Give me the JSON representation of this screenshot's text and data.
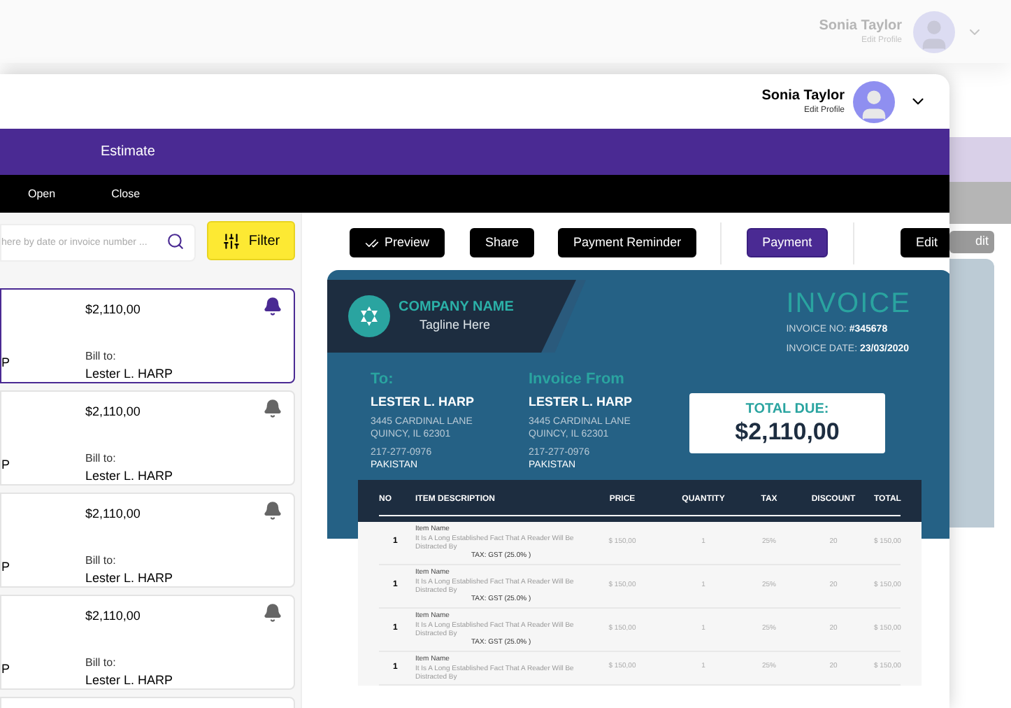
{
  "background": {
    "profile": {
      "name": "Sonia Taylor",
      "subtitle": "Edit Profile"
    },
    "edit_button": "dit"
  },
  "window": {
    "profile": {
      "name": "Sonia Taylor",
      "subtitle": "Edit Profile"
    },
    "nav_tabs": [
      {
        "label": "Estimate"
      }
    ],
    "sub_tabs": [
      {
        "label": "Open"
      },
      {
        "label": "Close"
      }
    ],
    "search": {
      "placeholder": "here by date or invoice number ..."
    },
    "filter_button": "Filter",
    "invoice_cards": [
      {
        "column_1": "P",
        "amount": "$2,110,00",
        "bill_to_label": "Bill to:",
        "bill_to": "Lester L. HARP",
        "selected": true
      },
      {
        "column_1": "P",
        "amount": "$2,110,00",
        "bill_to_label": "Bill to:",
        "bill_to": "Lester L. HARP",
        "selected": false
      },
      {
        "column_1": "P",
        "amount": "$2,110,00",
        "bill_to_label": "Bill to:",
        "bill_to": "Lester L. HARP",
        "selected": false
      },
      {
        "column_1": "P",
        "amount": "$2,110,00",
        "bill_to_label": "Bill to:",
        "bill_to": "Lester L. HARP",
        "selected": false
      }
    ],
    "actions": [
      {
        "label": "Preview",
        "kind": "check"
      },
      {
        "label": "Share",
        "kind": "plain"
      },
      {
        "label": "Payment Reminder",
        "kind": "plain"
      },
      {
        "label": "Payment",
        "kind": "primary"
      },
      {
        "label": "Edit",
        "kind": "plain"
      }
    ],
    "invoice": {
      "company_name": "COMPANY NAME",
      "tagline": "Tagline Here",
      "title": "INVOICE",
      "invoice_no_label": "INVOICE NO:",
      "invoice_no": "#345678",
      "invoice_date_label": "INVOICE DATE:",
      "invoice_date": "23/03/2020",
      "parties": [
        {
          "heading": "To:",
          "name": "LESTER L. HARP",
          "address_1": "3445 CARDINAL LANE",
          "address_2": "QUINCY, IL 62301",
          "phone": "217-277-0976",
          "country": "PAKISTAN"
        },
        {
          "heading": "Invoice From",
          "name": "LESTER L. HARP",
          "address_1": "3445 CARDINAL LANE",
          "address_2": "QUINCY, IL 62301",
          "phone": "217-277-0976",
          "country": "PAKISTAN"
        }
      ],
      "total_due_label": "TOTAL DUE:",
      "total_due": "$2,110,00",
      "table": {
        "columns": [
          "NO",
          "ITEM DESCRIPTION",
          "PRICE",
          "QUANTITY",
          "TAX",
          "DISCOUNT",
          "TOTAL"
        ],
        "rows": [
          {
            "no": "1",
            "item_name": "Item Name",
            "description": "It Is A Long Established Fact That A Reader Will Be Distracted By",
            "tax_note": "TAX: GST (25.0% )",
            "price": "$ 150,00",
            "quantity": "1",
            "tax": "25%",
            "discount": "20",
            "total": "$ 150,00"
          },
          {
            "no": "1",
            "item_name": "Item Name",
            "description": "It Is A Long Established Fact That A Reader Will Be Distracted By",
            "tax_note": "TAX: GST (25.0% )",
            "price": "$ 150,00",
            "quantity": "1",
            "tax": "25%",
            "discount": "20",
            "total": "$ 150,00"
          },
          {
            "no": "1",
            "item_name": "Item Name",
            "description": "It Is A Long Established Fact That A Reader Will Be Distracted By",
            "tax_note": "TAX: GST (25.0% )",
            "price": "$ 150,00",
            "quantity": "1",
            "tax": "25%",
            "discount": "20",
            "total": "$ 150,00"
          },
          {
            "no": "1",
            "item_name": "Item Name",
            "description": "It Is A Long Established Fact That A Reader Will Be Distracted By",
            "price": "$ 150,00",
            "quantity": "1",
            "tax": "25%",
            "discount": "20",
            "total": "$ 150,00"
          }
        ]
      }
    }
  }
}
